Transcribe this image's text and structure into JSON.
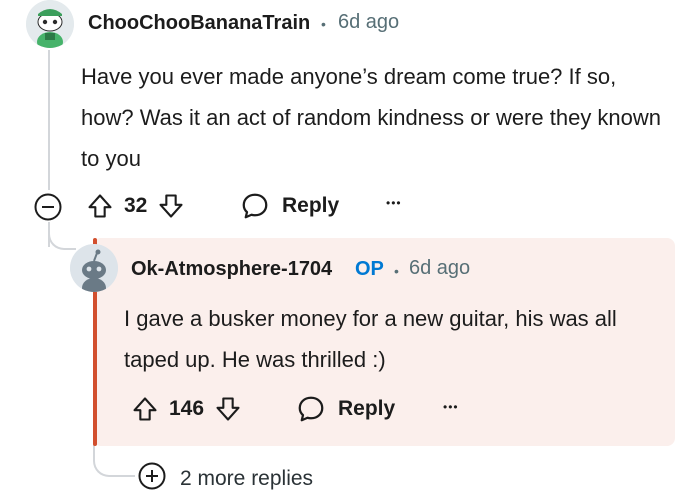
{
  "post": {
    "username": "ChooChooBananaTrain",
    "dot": "•",
    "age": "6d ago",
    "body": "Have you ever made anyone’s dream come true? If so, how? Was it an act of random kindness or were they known to you",
    "score": "32",
    "reply_label": "Reply",
    "more_label": "•••"
  },
  "reply": {
    "username": "Ok-Atmosphere-1704",
    "op_badge": "OP",
    "dot": "•",
    "age": "6d ago",
    "body": "I gave a busker money for a new guitar, his was all taped up. He was thrilled :)",
    "score": "146",
    "reply_label": "Reply",
    "more_label": "•••"
  },
  "more_replies": {
    "label": "2 more replies"
  },
  "colors": {
    "accent_blue": "#0079d3",
    "highlight_bg": "#fbefec",
    "op_bar": "#d24f2e"
  }
}
